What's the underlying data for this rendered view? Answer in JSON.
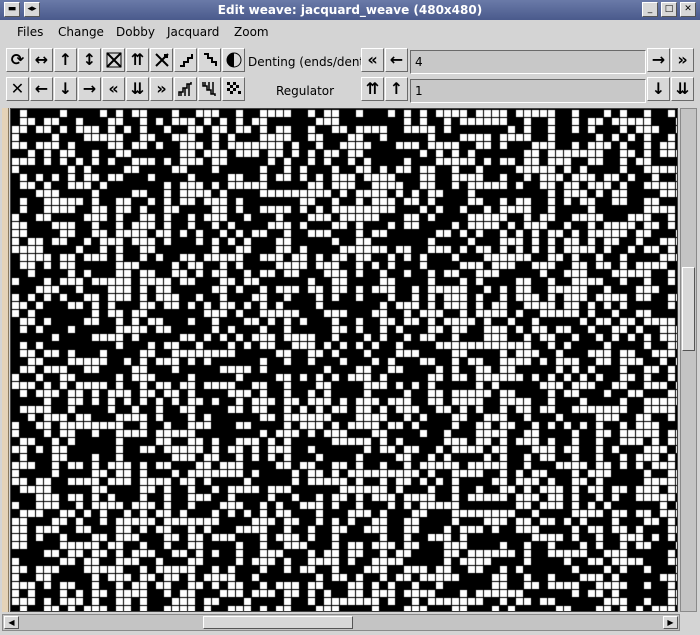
{
  "window": {
    "title": "Edit weave: jacquard_weave (480x480)"
  },
  "titlebar": {
    "menu_glyph": "▬",
    "pin_glyph": "◂▸",
    "minimize_glyph": "_",
    "maximize_glyph": "□",
    "close_glyph": "✕"
  },
  "menubar": {
    "items": [
      "Files",
      "Change",
      "Dobby",
      "Jacquard",
      "Zoom"
    ]
  },
  "toolbar": {
    "row1_icons": [
      "rotate-icon",
      "flip-horizontal-icon",
      "shift-up-icon",
      "flip-vertical-icon",
      "checker-icon",
      "double-up-icon",
      "diagonal-icon",
      "twill-right-icon",
      "twill-left-icon",
      "half-fill-icon"
    ],
    "row2_icons": [
      "clear-icon",
      "shift-left-icon",
      "shift-down-icon",
      "shift-right-icon",
      "double-left-icon",
      "double-down-icon",
      "double-right-icon",
      "steps-up-icon",
      "steps-down-icon",
      "random-icon"
    ],
    "denting_label": "Denting (ends/dent)",
    "denting_value": "4",
    "regulator_label": "Regulator",
    "regulator_value": "1"
  },
  "grid": {
    "columns": 480,
    "rows": 480,
    "cell_color_on": "#ffffff",
    "cell_color_off": "#000000",
    "grid_line_color": "#000000"
  }
}
